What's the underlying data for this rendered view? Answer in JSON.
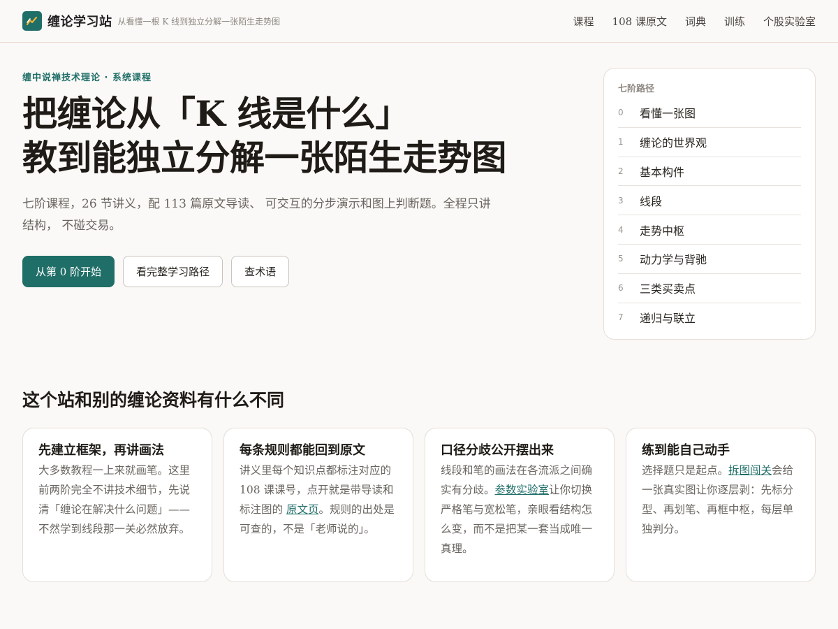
{
  "header": {
    "brand": "缠论学习站",
    "tagline": "从看懂一根 K 线到独立分解一张陌生走势图",
    "nav": [
      "课程",
      "108 课原文",
      "词典",
      "训练",
      "个股实验室"
    ]
  },
  "hero": {
    "eyebrow": "缠中说禅技术理论 · 系统课程",
    "title_line1": "把缠论从「K 线是什么」",
    "title_line2": "教到能独立分解一张陌生走势图",
    "desc": "七阶课程，26 节讲义，配 113 篇原文导读、 可交互的分步演示和图上判断题。全程只讲结构， 不碰交易。",
    "btn_primary": "从第 0 阶开始",
    "btn_path": "看完整学习路径",
    "btn_terms": "查术语"
  },
  "path": {
    "title": "七阶路径",
    "items": [
      {
        "num": "0",
        "label": "看懂一张图"
      },
      {
        "num": "1",
        "label": "缠论的世界观"
      },
      {
        "num": "2",
        "label": "基本构件"
      },
      {
        "num": "3",
        "label": "线段"
      },
      {
        "num": "4",
        "label": "走势中枢"
      },
      {
        "num": "5",
        "label": "动力学与背驰"
      },
      {
        "num": "6",
        "label": "三类买卖点"
      },
      {
        "num": "7",
        "label": "递归与联立"
      }
    ]
  },
  "section": {
    "title": "这个站和别的缠论资料有什么不同"
  },
  "features": [
    {
      "title": "先建立框架，再讲画法",
      "body_pre": "大多数教程一上来就画笔。这里前两阶完全不讲技术细节，先说清「缠论在解决什么问题」——不然学到线段那一关必然放弃。",
      "link": "",
      "body_post": ""
    },
    {
      "title": "每条规则都能回到原文",
      "body_pre": "讲义里每个知识点都标注对应的 108 课课号，点开就是带导读和标注图的 ",
      "link": "原文页",
      "body_post": "。规则的出处是可查的，不是「老师说的」。"
    },
    {
      "title": "口径分歧公开摆出来",
      "body_pre": "线段和笔的画法在各流派之间确实有分歧。",
      "link": "参数实验室",
      "body_post": "让你切换严格笔与宽松笔，亲眼看结构怎么变，而不是把某一套当成唯一真理。"
    },
    {
      "title": "练到能自己动手",
      "body_pre": "选择题只是起点。",
      "link": "拆图闯关",
      "body_post": "会给一张真实图让你逐层剥：先标分型、再划笔、再框中枢，每层单独判分。"
    }
  ],
  "colors": {
    "accent": "#1f6e67",
    "background": "#faf9f7",
    "border": "#e5ded9"
  }
}
